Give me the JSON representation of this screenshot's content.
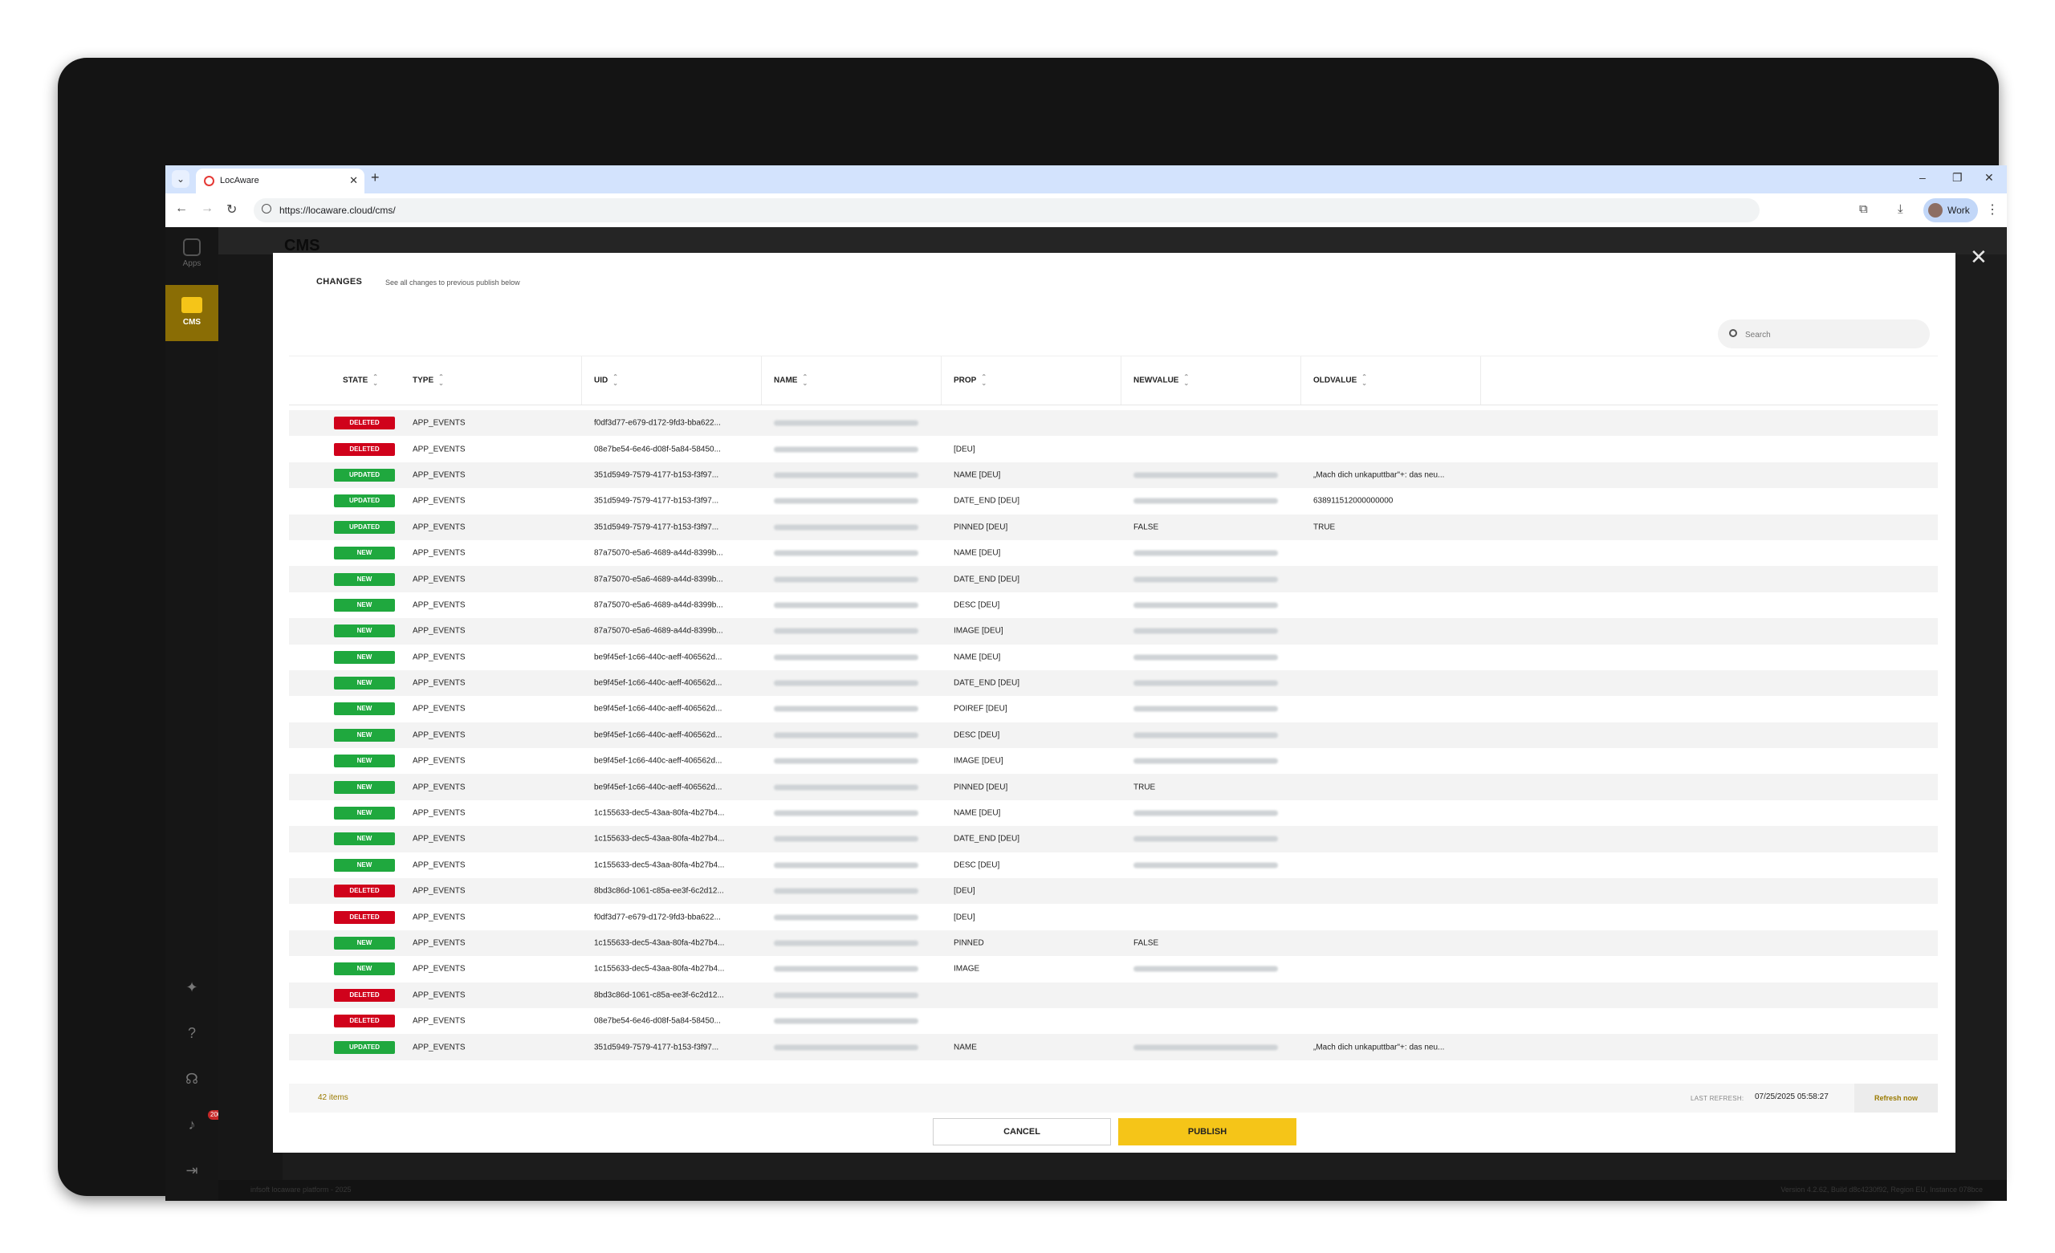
{
  "browser": {
    "tab_title": "LocAware",
    "url": "https://locaware.cloud/cms/",
    "profile": "Work"
  },
  "app": {
    "rail": {
      "apps_label": "Apps",
      "cms_label": "CMS",
      "notifications_count": "200"
    },
    "title": "CMS",
    "footer_left": "infsoft locaware platform - 2025",
    "footer_right": "Version 4.2.62, Build d8c4230f92, Region EU, Instance 078bce"
  },
  "modal": {
    "title": "CHANGES",
    "subtitle": "See all changes to previous publish below",
    "search_placeholder": "Search",
    "columns": [
      "STATE",
      "TYPE",
      "UID",
      "NAME",
      "PROP",
      "NEWVALUE",
      "OLDVALUE"
    ],
    "rows": [
      {
        "state": "DELETED",
        "type": "APP_EVENTS",
        "uid": "f0df3d77-e679-d172-9fd3-bba622...",
        "prop": "",
        "newvalue": "",
        "new_blur": false,
        "oldvalue": ""
      },
      {
        "state": "DELETED",
        "type": "APP_EVENTS",
        "uid": "08e7be54-6e46-d08f-5a84-58450...",
        "prop": "[DEU]",
        "newvalue": "",
        "new_blur": false,
        "oldvalue": ""
      },
      {
        "state": "UPDATED",
        "type": "APP_EVENTS",
        "uid": "351d5949-7579-4177-b153-f3f97...",
        "prop": "NAME [DEU]",
        "newvalue": "",
        "new_blur": true,
        "oldvalue": "„Mach dich unkaputtbar\"+: das neu..."
      },
      {
        "state": "UPDATED",
        "type": "APP_EVENTS",
        "uid": "351d5949-7579-4177-b153-f3f97...",
        "prop": "DATE_END [DEU]",
        "newvalue": "",
        "new_blur": true,
        "oldvalue": "638911512000000000"
      },
      {
        "state": "UPDATED",
        "type": "APP_EVENTS",
        "uid": "351d5949-7579-4177-b153-f3f97...",
        "prop": "PINNED [DEU]",
        "newvalue": "FALSE",
        "new_blur": false,
        "oldvalue": "TRUE"
      },
      {
        "state": "NEW",
        "type": "APP_EVENTS",
        "uid": "87a75070-e5a6-4689-a44d-8399b...",
        "prop": "NAME [DEU]",
        "newvalue": "",
        "new_blur": true,
        "oldvalue": ""
      },
      {
        "state": "NEW",
        "type": "APP_EVENTS",
        "uid": "87a75070-e5a6-4689-a44d-8399b...",
        "prop": "DATE_END [DEU]",
        "newvalue": "",
        "new_blur": true,
        "oldvalue": ""
      },
      {
        "state": "NEW",
        "type": "APP_EVENTS",
        "uid": "87a75070-e5a6-4689-a44d-8399b...",
        "prop": "DESC [DEU]",
        "newvalue": "",
        "new_blur": true,
        "oldvalue": ""
      },
      {
        "state": "NEW",
        "type": "APP_EVENTS",
        "uid": "87a75070-e5a6-4689-a44d-8399b...",
        "prop": "IMAGE [DEU]",
        "newvalue": "",
        "new_blur": true,
        "oldvalue": ""
      },
      {
        "state": "NEW",
        "type": "APP_EVENTS",
        "uid": "be9f45ef-1c66-440c-aeff-406562d...",
        "prop": "NAME [DEU]",
        "newvalue": "",
        "new_blur": true,
        "oldvalue": ""
      },
      {
        "state": "NEW",
        "type": "APP_EVENTS",
        "uid": "be9f45ef-1c66-440c-aeff-406562d...",
        "prop": "DATE_END [DEU]",
        "newvalue": "",
        "new_blur": true,
        "oldvalue": ""
      },
      {
        "state": "NEW",
        "type": "APP_EVENTS",
        "uid": "be9f45ef-1c66-440c-aeff-406562d...",
        "prop": "POIREF [DEU]",
        "newvalue": "",
        "new_blur": true,
        "oldvalue": ""
      },
      {
        "state": "NEW",
        "type": "APP_EVENTS",
        "uid": "be9f45ef-1c66-440c-aeff-406562d...",
        "prop": "DESC [DEU]",
        "newvalue": "",
        "new_blur": true,
        "oldvalue": ""
      },
      {
        "state": "NEW",
        "type": "APP_EVENTS",
        "uid": "be9f45ef-1c66-440c-aeff-406562d...",
        "prop": "IMAGE [DEU]",
        "newvalue": "",
        "new_blur": true,
        "oldvalue": ""
      },
      {
        "state": "NEW",
        "type": "APP_EVENTS",
        "uid": "be9f45ef-1c66-440c-aeff-406562d...",
        "prop": "PINNED [DEU]",
        "newvalue": "TRUE",
        "new_blur": false,
        "oldvalue": ""
      },
      {
        "state": "NEW",
        "type": "APP_EVENTS",
        "uid": "1c155633-dec5-43aa-80fa-4b27b4...",
        "prop": "NAME [DEU]",
        "newvalue": "",
        "new_blur": true,
        "oldvalue": ""
      },
      {
        "state": "NEW",
        "type": "APP_EVENTS",
        "uid": "1c155633-dec5-43aa-80fa-4b27b4...",
        "prop": "DATE_END [DEU]",
        "newvalue": "",
        "new_blur": true,
        "oldvalue": ""
      },
      {
        "state": "NEW",
        "type": "APP_EVENTS",
        "uid": "1c155633-dec5-43aa-80fa-4b27b4...",
        "prop": "DESC [DEU]",
        "newvalue": "",
        "new_blur": true,
        "oldvalue": ""
      },
      {
        "state": "DELETED",
        "type": "APP_EVENTS",
        "uid": "8bd3c86d-1061-c85a-ee3f-6c2d12...",
        "prop": "[DEU]",
        "newvalue": "",
        "new_blur": false,
        "oldvalue": ""
      },
      {
        "state": "DELETED",
        "type": "APP_EVENTS",
        "uid": "f0df3d77-e679-d172-9fd3-bba622...",
        "prop": "[DEU]",
        "newvalue": "",
        "new_blur": false,
        "oldvalue": ""
      },
      {
        "state": "NEW",
        "type": "APP_EVENTS",
        "uid": "1c155633-dec5-43aa-80fa-4b27b4...",
        "prop": "PINNED",
        "newvalue": "FALSE",
        "new_blur": false,
        "oldvalue": ""
      },
      {
        "state": "NEW",
        "type": "APP_EVENTS",
        "uid": "1c155633-dec5-43aa-80fa-4b27b4...",
        "prop": "IMAGE",
        "newvalue": "",
        "new_blur": true,
        "oldvalue": ""
      },
      {
        "state": "DELETED",
        "type": "APP_EVENTS",
        "uid": "8bd3c86d-1061-c85a-ee3f-6c2d12...",
        "prop": "",
        "newvalue": "",
        "new_blur": false,
        "oldvalue": ""
      },
      {
        "state": "DELETED",
        "type": "APP_EVENTS",
        "uid": "08e7be54-6e46-d08f-5a84-58450...",
        "prop": "",
        "newvalue": "",
        "new_blur": false,
        "oldvalue": ""
      },
      {
        "state": "UPDATED",
        "type": "APP_EVENTS",
        "uid": "351d5949-7579-4177-b153-f3f97...",
        "prop": "NAME",
        "newvalue": "",
        "new_blur": true,
        "oldvalue": "„Mach dich unkaputtbar\"+: das neu..."
      }
    ],
    "items_count": "42 items",
    "last_refresh_label": "LAST REFRESH:",
    "last_refresh_time": "07/25/2025 05:58:27",
    "refresh_label": "Refresh now",
    "cancel_label": "CANCEL",
    "publish_label": "PUBLISH"
  },
  "colors": {
    "accent": "#f5c518",
    "deleted": "#d0021b",
    "new_updated": "#1fa83e"
  }
}
